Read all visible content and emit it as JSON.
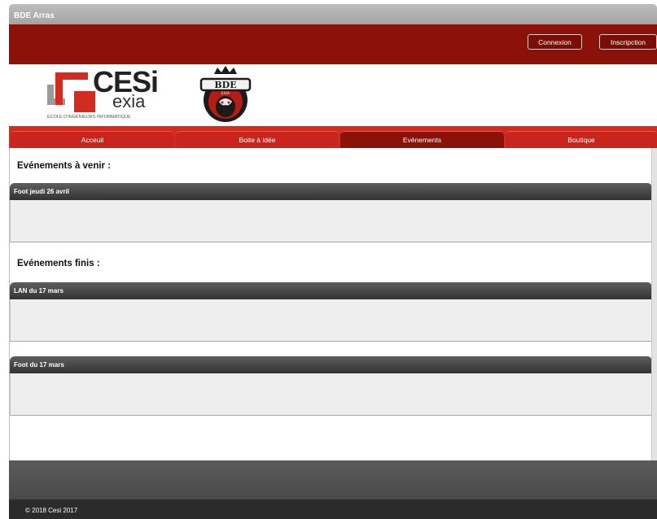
{
  "window": {
    "title": "BDE Arras"
  },
  "header": {
    "login_label": "Connexion",
    "register_label": "Inscripction"
  },
  "logos": {
    "cesi_name": "CESi",
    "cesi_sub": "exia",
    "cesi_tagline": "ÉCOLE D'INGÉNIEURS INFORMATIQUE",
    "bde_badge_text": "BDE",
    "bde_badge_sub": "EXIA"
  },
  "nav": {
    "tabs": [
      {
        "label": "Acceuil"
      },
      {
        "label": "Boite à idée"
      },
      {
        "label": "Evénements"
      },
      {
        "label": "Boutique"
      }
    ],
    "active_index": 2
  },
  "main": {
    "upcoming_title": "Evénements à venir :",
    "upcoming": [
      {
        "title": "Foot jeudi 26 avril"
      }
    ],
    "finished_title": "Evénements finis :",
    "finished": [
      {
        "title": "LAN du 17 mars"
      },
      {
        "title": "Foot du 17 mars"
      }
    ]
  },
  "footer": {
    "copyright": "© 2018 Cesi 2017"
  },
  "colors": {
    "brand_red": "#d42b21",
    "dark_red": "#8b1208",
    "panel_dark": "#333333"
  }
}
